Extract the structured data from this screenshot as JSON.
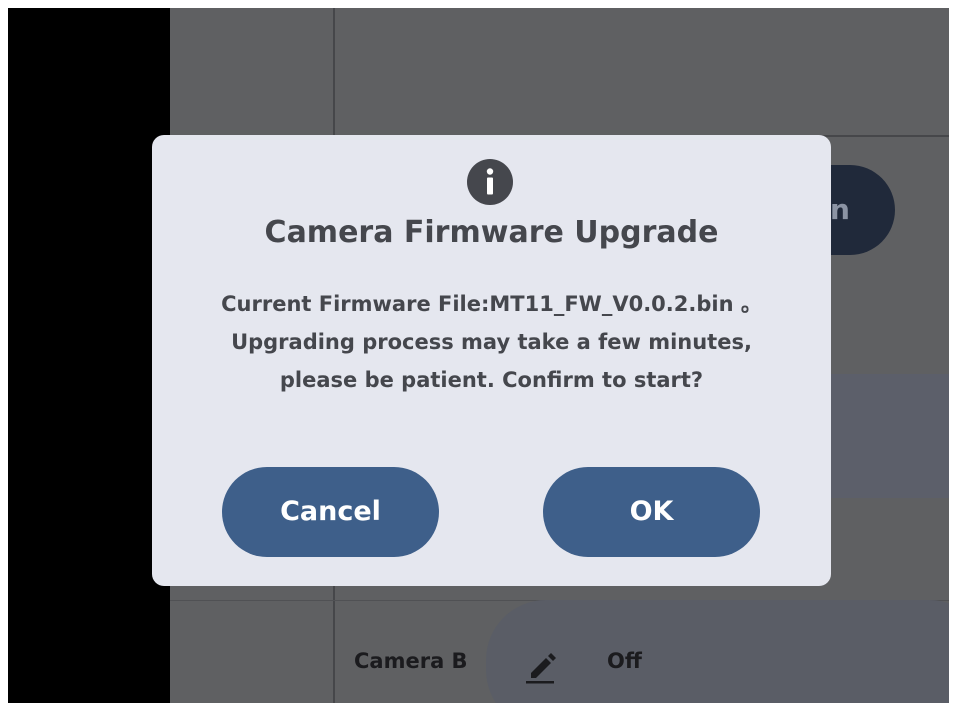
{
  "background": {
    "partial_button_text": "n",
    "camera_row": {
      "label": "Camera B",
      "edit_icon": "pencil-icon",
      "value": "Off"
    }
  },
  "dialog": {
    "icon": "info-icon",
    "title": "Camera Firmware Upgrade",
    "message_lines": [
      "Current Firmware File:MT11_FW_V0.0.2.bin 。",
      "Upgrading process may take a few minutes,",
      "please be patient. Confirm to start?"
    ],
    "cancel_label": "Cancel",
    "ok_label": "OK"
  },
  "colors": {
    "dialog_bg": "#e5e7ef",
    "button_bg": "#3e5f8a",
    "text": "#45474d",
    "overlay": "#5f6062"
  }
}
